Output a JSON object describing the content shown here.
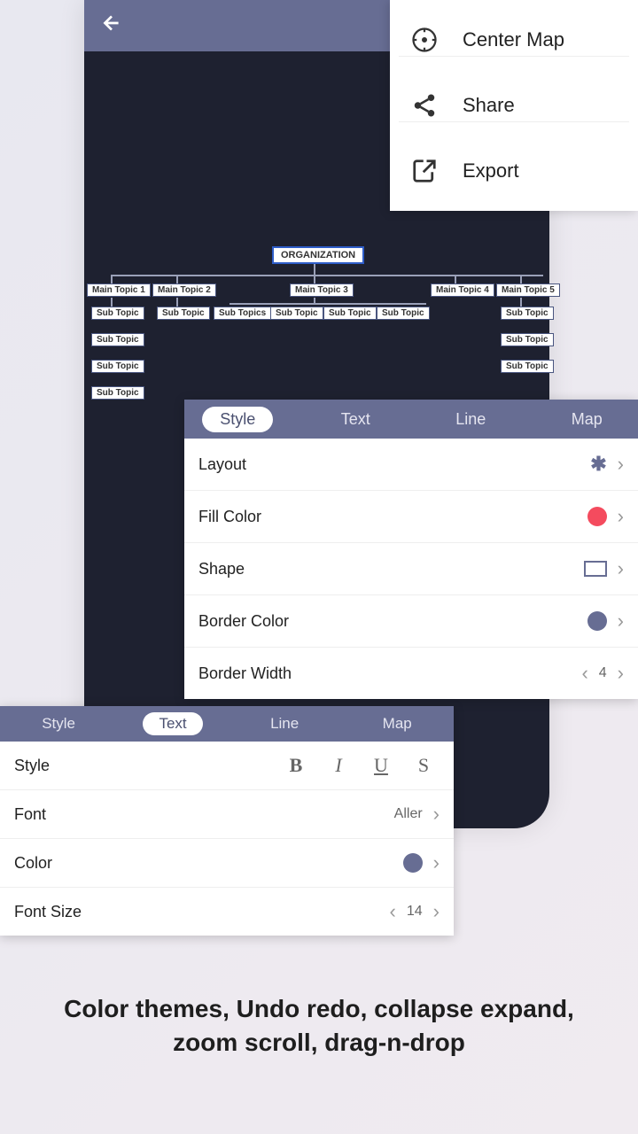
{
  "menu": {
    "items": [
      {
        "label": "Center Map"
      },
      {
        "label": "Share"
      },
      {
        "label": "Export"
      }
    ]
  },
  "org": {
    "root": "ORGANIZATION",
    "main": [
      "Main Topic 1",
      "Main Topic 2",
      "Main Topic 3",
      "Main Topic 4",
      "Main Topic 5"
    ],
    "subs1": [
      "Sub Topic",
      "Sub Topic",
      "Sub Topics",
      "Sub Topic",
      "Sub Topic",
      "Sub Topic"
    ],
    "subs_left": [
      "Sub Topic",
      "Sub Topic",
      "Sub Topic"
    ],
    "subs_right": [
      "Sub Topic",
      "Sub Topic",
      "Sub Topic"
    ]
  },
  "stylePanel": {
    "tabs": [
      "Style",
      "Text",
      "Line",
      "Map"
    ],
    "rows": {
      "layout": "Layout",
      "fillColor": "Fill Color",
      "shape": "Shape",
      "borderColor": "Border Color",
      "borderWidth": "Border Width"
    },
    "fillColorValue": "#f44b5e",
    "borderColorValue": "#676d93",
    "borderWidthValue": "4"
  },
  "textPanel": {
    "tabs": [
      "Style",
      "Text",
      "Line",
      "Map"
    ],
    "rows": {
      "style": "Style",
      "font": "Font",
      "color": "Color",
      "fontSize": "Font Size"
    },
    "fontValue": "Aller",
    "colorValue": "#676d93",
    "fontSizeValue": "14"
  },
  "caption": {
    "line1": "Color themes, Undo redo, collapse expand,",
    "line2": "zoom scroll, drag-n-drop"
  }
}
